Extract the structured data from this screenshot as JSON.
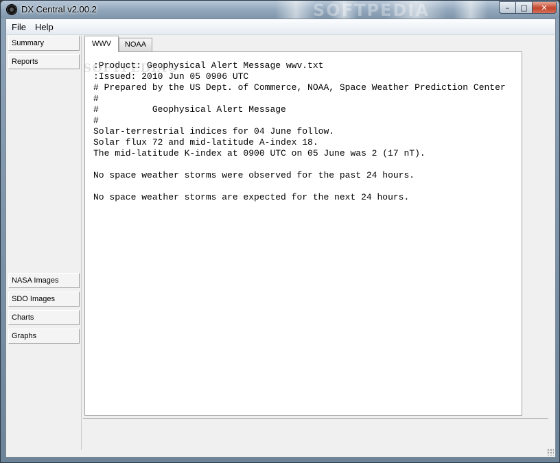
{
  "window": {
    "title": "DX Central  v2.00.2",
    "watermark": "SOFTPEDIA",
    "controls": {
      "minimize": "–",
      "maximize": "□",
      "close": "✕"
    }
  },
  "menu": {
    "file": "File",
    "help": "Help"
  },
  "sidebar": {
    "top_items": [
      "Summary",
      "Reports"
    ],
    "bottom_items": [
      "NASA Images",
      "SDO Images",
      "Charts",
      "Graphs"
    ]
  },
  "tabs": {
    "active": "WWV",
    "inactive": "NOAA",
    "watermark": "SOFTPEDIA®"
  },
  "content": {
    "lines": [
      ":Product: Geophysical Alert Message wwv.txt",
      ":Issued: 2010 Jun 05 0906 UTC",
      "# Prepared by the US Dept. of Commerce, NOAA, Space Weather Prediction Center",
      "#",
      "#          Geophysical Alert Message",
      "#",
      "Solar-terrestrial indices for 04 June follow.",
      "Solar flux 72 and mid-latitude A-index 18.",
      "The mid-latitude K-index at 0900 UTC on 05 June was 2 (17 nT).",
      "",
      "No space weather storms were observed for the past 24 hours.",
      "",
      "No space weather storms are expected for the next 24 hours."
    ]
  },
  "icons": {
    "app": "app-globe-icon",
    "resize": "resize-grip-icon"
  },
  "colors": {
    "panel_bg": "#ffffff",
    "window_frame": "#7f95aa",
    "close_button": "#c2452c"
  }
}
